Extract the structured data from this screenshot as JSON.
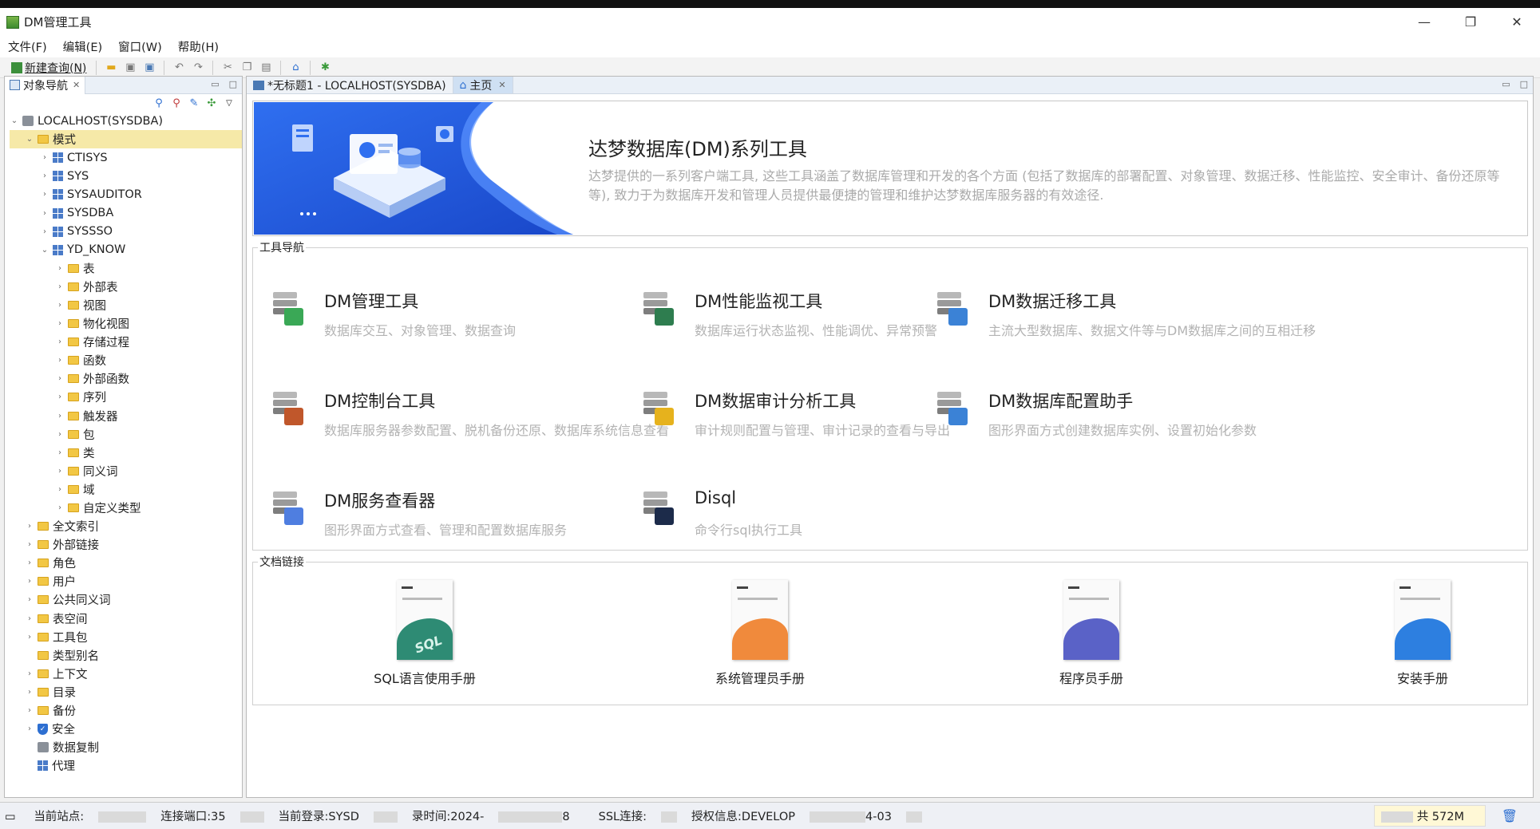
{
  "window": {
    "title": "DM管理工具",
    "minimize": "—",
    "restore": "❐",
    "close": "✕"
  },
  "menu": [
    "文件(F)",
    "编辑(E)",
    "窗口(W)",
    "帮助(H)"
  ],
  "toolbar": {
    "new_query": "新建查询(N)"
  },
  "navigator": {
    "tab_label": "对象导航",
    "tree": [
      {
        "label": "LOCALHOST(SYSDBA)",
        "icon": "database-icon",
        "level": 0,
        "expand": "open"
      },
      {
        "label": "模式",
        "icon": "folder-icon",
        "level": 1,
        "expand": "open",
        "selected": true
      },
      {
        "label": "CTISYS",
        "icon": "schema-icon",
        "level": 2,
        "expand": "closed"
      },
      {
        "label": "SYS",
        "icon": "schema-icon",
        "level": 2,
        "expand": "closed"
      },
      {
        "label": "SYSAUDITOR",
        "icon": "schema-icon",
        "level": 2,
        "expand": "closed"
      },
      {
        "label": "SYSDBA",
        "icon": "schema-icon",
        "level": 2,
        "expand": "closed"
      },
      {
        "label": "SYSSSO",
        "icon": "schema-icon",
        "level": 2,
        "expand": "closed"
      },
      {
        "label": "YD_KNOW",
        "icon": "schema-icon",
        "level": 2,
        "expand": "open"
      },
      {
        "label": "表",
        "icon": "folder-icon",
        "level": 3,
        "expand": "closed"
      },
      {
        "label": "外部表",
        "icon": "folder-icon",
        "level": 3,
        "expand": "closed"
      },
      {
        "label": "视图",
        "icon": "folder-icon",
        "level": 3,
        "expand": "closed"
      },
      {
        "label": "物化视图",
        "icon": "folder-icon",
        "level": 3,
        "expand": "closed"
      },
      {
        "label": "存储过程",
        "icon": "folder-icon",
        "level": 3,
        "expand": "closed"
      },
      {
        "label": "函数",
        "icon": "folder-icon",
        "level": 3,
        "expand": "closed"
      },
      {
        "label": "外部函数",
        "icon": "folder-icon",
        "level": 3,
        "expand": "closed"
      },
      {
        "label": "序列",
        "icon": "folder-icon",
        "level": 3,
        "expand": "closed"
      },
      {
        "label": "触发器",
        "icon": "folder-icon",
        "level": 3,
        "expand": "closed"
      },
      {
        "label": "包",
        "icon": "folder-icon",
        "level": 3,
        "expand": "closed"
      },
      {
        "label": "类",
        "icon": "folder-icon",
        "level": 3,
        "expand": "closed"
      },
      {
        "label": "同义词",
        "icon": "folder-icon",
        "level": 3,
        "expand": "closed"
      },
      {
        "label": "域",
        "icon": "folder-icon",
        "level": 3,
        "expand": "closed"
      },
      {
        "label": "自定义类型",
        "icon": "folder-icon",
        "level": 3,
        "expand": "closed"
      },
      {
        "label": "全文索引",
        "icon": "folder-icon",
        "level": 1,
        "expand": "closed"
      },
      {
        "label": "外部链接",
        "icon": "folder-icon",
        "level": 1,
        "expand": "closed"
      },
      {
        "label": "角色",
        "icon": "folder-icon",
        "level": 1,
        "expand": "closed"
      },
      {
        "label": "用户",
        "icon": "folder-icon",
        "level": 1,
        "expand": "closed"
      },
      {
        "label": "公共同义词",
        "icon": "folder-icon",
        "level": 1,
        "expand": "closed"
      },
      {
        "label": "表空间",
        "icon": "folder-icon",
        "level": 1,
        "expand": "closed"
      },
      {
        "label": "工具包",
        "icon": "folder-icon",
        "level": 1,
        "expand": "closed"
      },
      {
        "label": "类型别名",
        "icon": "folder-icon",
        "level": 1,
        "expand": "none"
      },
      {
        "label": "上下文",
        "icon": "folder-icon",
        "level": 1,
        "expand": "closed"
      },
      {
        "label": "目录",
        "icon": "folder-icon",
        "level": 1,
        "expand": "closed"
      },
      {
        "label": "备份",
        "icon": "folder-icon",
        "level": 1,
        "expand": "closed"
      },
      {
        "label": "安全",
        "icon": "shield-icon",
        "level": 1,
        "expand": "closed"
      },
      {
        "label": "数据复制",
        "icon": "replication-icon",
        "level": 1,
        "expand": "none"
      },
      {
        "label": "代理",
        "icon": "agent-icon",
        "level": 1,
        "expand": "none"
      }
    ]
  },
  "editor_tabs": [
    {
      "label": "*无标题1 - LOCALHOST(SYSDBA)",
      "active": false
    },
    {
      "label": "主页",
      "active": true
    }
  ],
  "banner": {
    "title": "达梦数据库(DM)系列工具",
    "description": "达梦提供的一系列客户端工具, 这些工具涵盖了数据库管理和开发的各个方面 (包括了数据库的部署配置、对象管理、数据迁移、性能监控、安全审计、备份还原等等), 致力于为数据库开发和管理人员提供最便捷的管理和维护达梦数据库服务器的有效途径."
  },
  "tool_nav": {
    "label": "工具导航",
    "tools": [
      {
        "name": "DM管理工具",
        "desc": "数据库交互、对象管理、数据查询",
        "accent": "#3aa856"
      },
      {
        "name": "DM性能监视工具",
        "desc": "数据库运行状态监视、性能调优、异常预警",
        "accent": "#2e7d4f"
      },
      {
        "name": "DM数据迁移工具",
        "desc": "主流大型数据库、数据文件等与DM数据库之间的互相迁移",
        "accent": "#3b82d6"
      },
      {
        "name": "DM控制台工具",
        "desc": "数据库服务器参数配置、脱机备份还原、数据库系统信息查看",
        "accent": "#c0572b"
      },
      {
        "name": "DM数据审计分析工具",
        "desc": "审计规则配置与管理、审计记录的查看与导出",
        "accent": "#e6b21d"
      },
      {
        "name": "DM数据库配置助手",
        "desc": "图形界面方式创建数据库实例、设置初始化参数",
        "accent": "#3b82d6"
      },
      {
        "name": "DM服务查看器",
        "desc": "图形界面方式查看、管理和配置数据库服务",
        "accent": "#4f7ee0"
      },
      {
        "name": "Disql",
        "desc": "命令行sql执行工具",
        "accent": "#1c2b4a"
      }
    ]
  },
  "doc_links": {
    "label": "文档链接",
    "docs": [
      {
        "name": "SQL语言使用手册",
        "cover_text": "SQL",
        "accent": "#2e8b74"
      },
      {
        "name": "系统管理员手册",
        "cover_text": "",
        "accent": "#f08a3c"
      },
      {
        "name": "程序员手册",
        "cover_text": "",
        "accent": "#5a62c7"
      },
      {
        "name": "安装手册",
        "cover_text": "",
        "accent": "#2d7fe0"
      }
    ]
  },
  "status": {
    "site": "当前站点:",
    "port": "连接端口:35",
    "login": "当前登录:SYSD",
    "login_time": "录时间:2024-",
    "login_time_tail": "8",
    "ssl": "SSL连接:",
    "license": "授权信息:DEVELOP",
    "license_tail": "4-03",
    "memory": "共 572M"
  }
}
